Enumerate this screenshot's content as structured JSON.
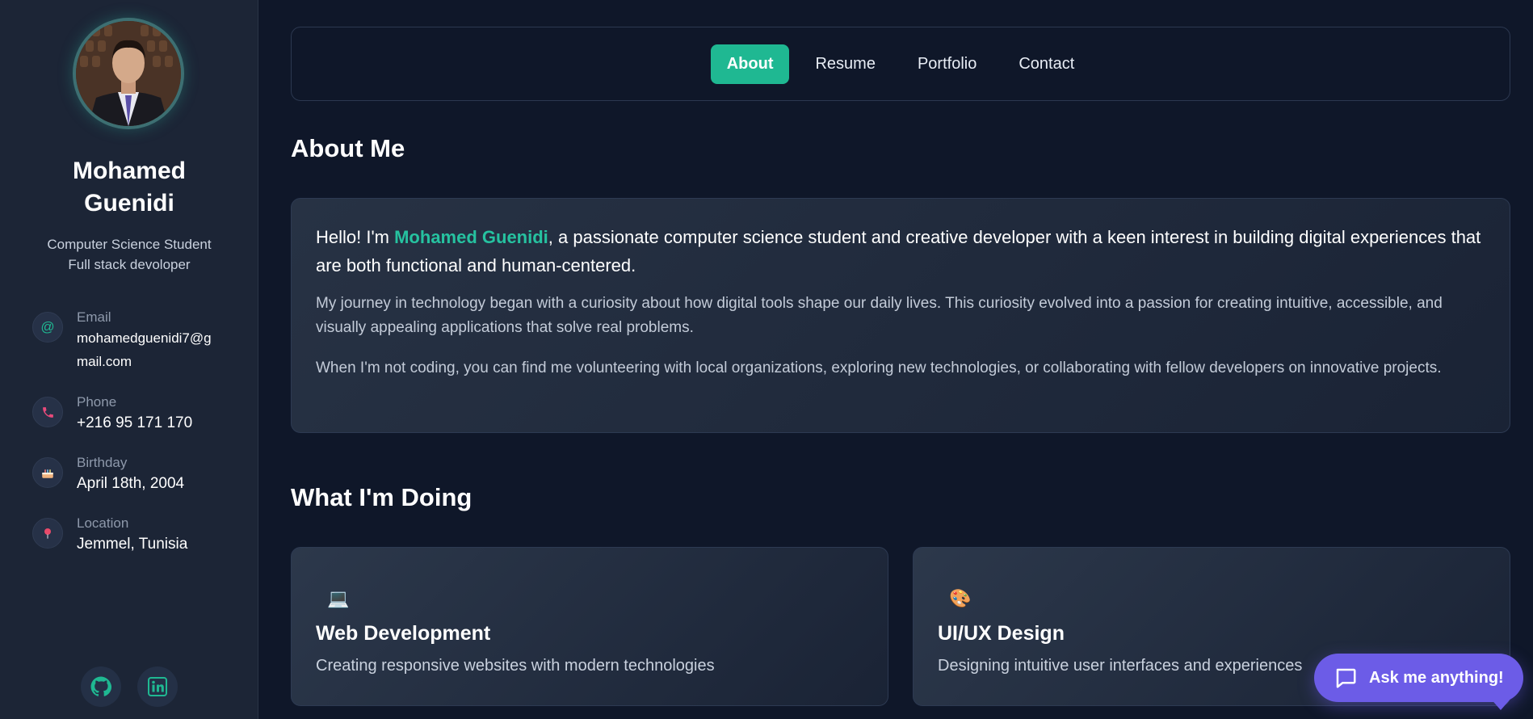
{
  "profile": {
    "name": "Mohamed Guenidi",
    "role_line1": "Computer Science Student",
    "role_line2": "Full stack devoloper"
  },
  "contacts": [
    {
      "label": "Email",
      "value": "mohamedguenidi7@gmail.com",
      "icon": "at-icon"
    },
    {
      "label": "Phone",
      "value": "+216 95 171 170",
      "icon": "phone-icon"
    },
    {
      "label": "Birthday",
      "value": "April 18th, 2004",
      "icon": "cake-icon"
    },
    {
      "label": "Location",
      "value": "Jemmel, Tunisia",
      "icon": "pin-icon"
    }
  ],
  "social": [
    {
      "name": "github-icon"
    },
    {
      "name": "linkedin-icon"
    }
  ],
  "nav": {
    "items": [
      "About",
      "Resume",
      "Portfolio",
      "Contact"
    ],
    "active": "About"
  },
  "about": {
    "title": "About Me",
    "lead_prefix": "Hello! I'm ",
    "lead_name": "Mohamed Guenidi",
    "lead_suffix": ", a passionate computer science student and creative developer with a keen interest in building digital experiences that are both functional and human-centered.",
    "p1": "My journey in technology began with a curiosity about how digital tools shape our daily lives. This curiosity evolved into a passion for creating intuitive, accessible, and visually appealing applications that solve real problems.",
    "p2": "When I'm not coding, you can find me volunteering with local organizations, exploring new technologies, or collaborating with fellow developers on innovative projects."
  },
  "doing": {
    "title": "What I'm Doing",
    "services": [
      {
        "icon": "💻",
        "title": "Web Development",
        "desc": "Creating responsive websites with modern technologies"
      },
      {
        "icon": "🎨",
        "title": "UI/UX Design",
        "desc": "Designing intuitive user interfaces and experiences"
      }
    ]
  },
  "chat": {
    "label": "Ask me anything!"
  },
  "colors": {
    "accent": "#1fb892",
    "highlight": "#26c2a0",
    "chat": "#6c5ce7",
    "background": "#0f1729",
    "sidebar": "#1c2536"
  }
}
